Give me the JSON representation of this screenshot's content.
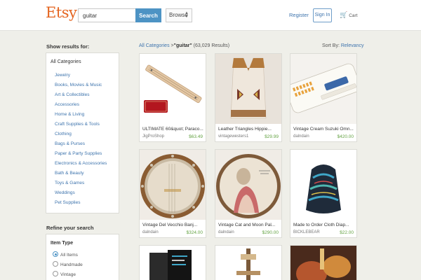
{
  "header": {
    "logo": "Etsy",
    "search_value": "guitar",
    "search_button": "Search",
    "browse": "Browse",
    "register": "Register",
    "sign_in": "Sign In",
    "cart": "Cart"
  },
  "sidebar": {
    "show_results": "Show results for:",
    "all_categories": "All Categories",
    "categories": [
      "Jewelry",
      "Books, Movies & Music",
      "Art & Collectibles",
      "Accessories",
      "Home & Living",
      "Craft Supplies & Tools",
      "Clothing",
      "Bags & Purses",
      "Paper & Party Supplies",
      "Electronics & Accessories",
      "Bath & Beauty",
      "Toys & Games",
      "Weddings",
      "Pet Supplies"
    ],
    "refine": "Refine your search",
    "item_type": "Item Type",
    "item_type_options": [
      "All Items",
      "Handmade",
      "Vintage"
    ],
    "item_type_selected": "All Items"
  },
  "results": {
    "breadcrumb_link": "All Categories",
    "breadcrumb_sep": ">",
    "query": "\"guitar\"",
    "count": "(63,029 Results)",
    "sort_label": "Sort By:",
    "sort_value": "Relevancy"
  },
  "listings": [
    {
      "title": "ULTIMATE 60&quot; Paraco...",
      "shop": "JigProShop",
      "price": "$63.49",
      "image": "jigpro-guitar-kit-image"
    },
    {
      "title": "Leather Triangles Hippie...",
      "shop": "vintagewesters1",
      "price": "$29.99",
      "image": "leather-vest-image"
    },
    {
      "title": "Vintage Cream Suzuki Omn...",
      "shop": "dalndain",
      "price": "$420.00",
      "image": "omnichord-image"
    },
    {
      "title": "Vintage Del Vecchio Banj...",
      "shop": "dalndain",
      "price": "$324.00",
      "image": "banjo-image"
    },
    {
      "title": "Vintage Cat and Moon Pal...",
      "shop": "dalndain",
      "price": "$290.00",
      "image": "painted-banjo-image"
    },
    {
      "title": "Made to Order Cloth Diap...",
      "shop": "BICKLEBEAR",
      "price": "$22.00",
      "image": "cloth-diaper-image"
    },
    {
      "image": "dark-book-image"
    },
    {
      "image": "lamp-image"
    },
    {
      "image": "guitar-art-image"
    }
  ],
  "colors": {
    "brand": "#e4641f",
    "accent": "#4d93c4",
    "link": "#3e74ad",
    "price": "#65a344"
  }
}
